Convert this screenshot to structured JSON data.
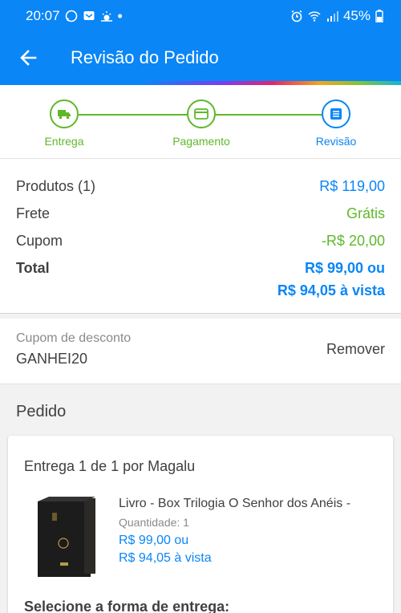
{
  "status_bar": {
    "time": "20:07",
    "battery": "45%",
    "icons_left": [
      "whatsapp-icon",
      "messaging-icon",
      "weather-icon",
      "dot-icon"
    ],
    "icons_right": [
      "alarm-icon",
      "wifi-icon",
      "signal-icon",
      "battery-icon"
    ]
  },
  "appbar": {
    "title": "Revisão do Pedido",
    "back_icon": "arrow-left-icon"
  },
  "steps": [
    {
      "label": "Entrega",
      "icon": "truck-icon"
    },
    {
      "label": "Pagamento",
      "icon": "card-icon"
    },
    {
      "label": "Revisão",
      "icon": "list-icon"
    }
  ],
  "summary": {
    "produtos_label": "Produtos (1)",
    "produtos_value": "R$ 119,00",
    "frete_label": "Frete",
    "frete_value": "Grátis",
    "cupom_label": "Cupom",
    "cupom_value": "-R$ 20,00",
    "total_label": "Total",
    "total_value_line1": "R$ 99,00 ou",
    "total_value_line2": "R$ 94,05 à vista"
  },
  "coupon": {
    "label": "Cupom de desconto",
    "code": "GANHEI20",
    "remove": "Remover"
  },
  "pedido": {
    "title": "Pedido",
    "delivery": "Entrega 1 de 1 por Magalu",
    "product": {
      "name": "Livro - Box Trilogia O Senhor dos Anéis -",
      "quantity": "Quantidade:  1",
      "price_line1": "R$ 99,00 ou",
      "price_line2": "R$ 94,05 à vista"
    },
    "select_delivery": "Selecione a forma de entrega:"
  },
  "colors": {
    "primary": "#0a86f6",
    "success": "#5fb82a",
    "text": "#404040",
    "muted": "#8a8a8a"
  }
}
